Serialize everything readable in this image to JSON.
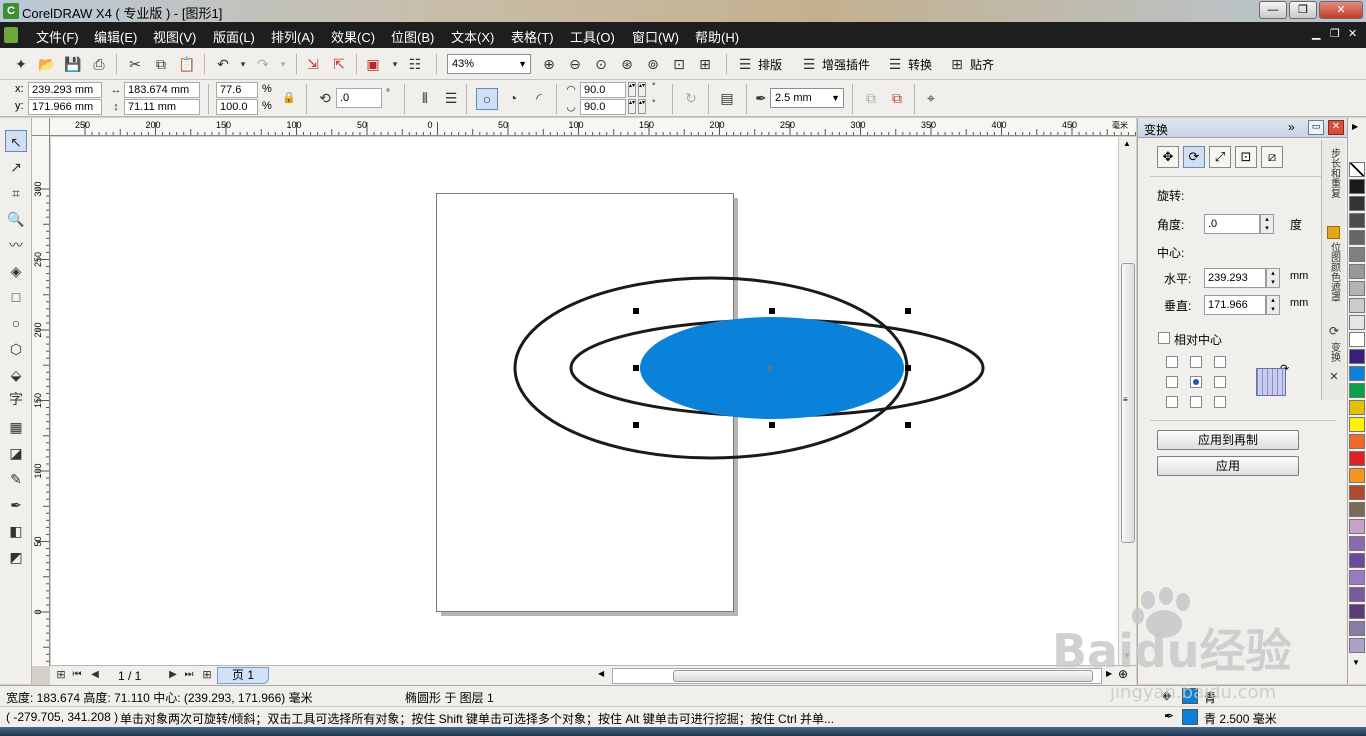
{
  "titlebar": {
    "title": "CorelDRAW X4 ( 专业版 ) - [图形1]",
    "min_label": "—",
    "max_label": "❐",
    "close_label": "✕"
  },
  "menu": {
    "items": [
      "文件(F)",
      "编辑(E)",
      "视图(V)",
      "版面(L)",
      "排列(A)",
      "效果(C)",
      "位图(B)",
      "文本(X)",
      "表格(T)",
      "工具(O)",
      "窗口(W)",
      "帮助(H)"
    ]
  },
  "toolbar1": {
    "zoom": "43%",
    "btn_layout": "排版",
    "btn_plugin": "增强插件",
    "btn_convert": "转换",
    "btn_align": "贴齐"
  },
  "propbar": {
    "x_label": "x:",
    "x_value": "239.293 mm",
    "y_label": "y:",
    "y_value": "171.966 mm",
    "w_value": "183.674 mm",
    "h_value": "71.11 mm",
    "scale_x": "77.6",
    "scale_y": "100.0",
    "percent": "%",
    "rotation": ".0",
    "degree": "°",
    "angle_start": "90.0",
    "angle_end": "90.0",
    "outline_width": "2.5 mm"
  },
  "ruler": {
    "h_ticks": [
      "250",
      "200",
      "150",
      "100",
      "50",
      "0",
      "50",
      "100",
      "150",
      "200",
      "250",
      "300",
      "350",
      "400",
      "450"
    ],
    "h_unit": "毫米",
    "v_ticks": [
      "300",
      "250",
      "200",
      "150",
      "100",
      "50",
      "0"
    ]
  },
  "pagebar": {
    "page_count": "1 / 1",
    "page_tab": "页 1"
  },
  "docker": {
    "title": "变换",
    "section_rotate": "旋转:",
    "angle_label": "角度:",
    "angle_value": ".0",
    "angle_unit": "度",
    "center_label": "中心:",
    "horizontal_label": "水平:",
    "horizontal_value": "239.293",
    "vertical_label": "垂直:",
    "vertical_value": "171.966",
    "unit_mm": "mm",
    "relative_center": "相对中心",
    "apply_duplicate": "应用到再制",
    "apply": "应用",
    "side_tabs": [
      "步长和重复",
      "位图颜色遮罩",
      "变换"
    ]
  },
  "palette": {
    "colors": [
      "#ffffff",
      "#1a1a1a",
      "#333333",
      "#4d4d4d",
      "#666666",
      "#808080",
      "#999999",
      "#b3b3b3",
      "#cccccc",
      "#e5e5e5",
      "#ffffff",
      "#3a1e7a",
      "#0a82d9",
      "#0aa14a",
      "#e3c100",
      "#fff200",
      "#f2672a",
      "#e02020",
      "#f7941d",
      "#b04a2a",
      "#7a6a5a",
      "#c8a0c8",
      "#8a6ab0",
      "#6a4a9a",
      "#9a7ac0",
      "#7a5a9a",
      "#5a3a7a",
      "#8a7aa8",
      "#b0a0c8"
    ]
  },
  "status": {
    "dimensions": "宽度: 183.674 高度: 71.110 中心: (239.293, 171.966) 毫米",
    "object_info": "椭圆形 于 图层 1",
    "cursor_pos": "( -279.705, 341.208 )",
    "hint": "单击对象两次可旋转/倾斜；双击工具可选择所有对象；按住 Shift 键单击可选择多个对象；按住 Alt 键单击可进行挖掘；按住 Ctrl 并单...",
    "fill_label": "青",
    "outline_label": "青  2.500 毫米"
  },
  "colors": {
    "fill_cyan": "#0a82d9",
    "outline": "#1a1a1a"
  },
  "watermark": {
    "brand": "Baidu经验",
    "url": "jingyan.baidu.com"
  }
}
